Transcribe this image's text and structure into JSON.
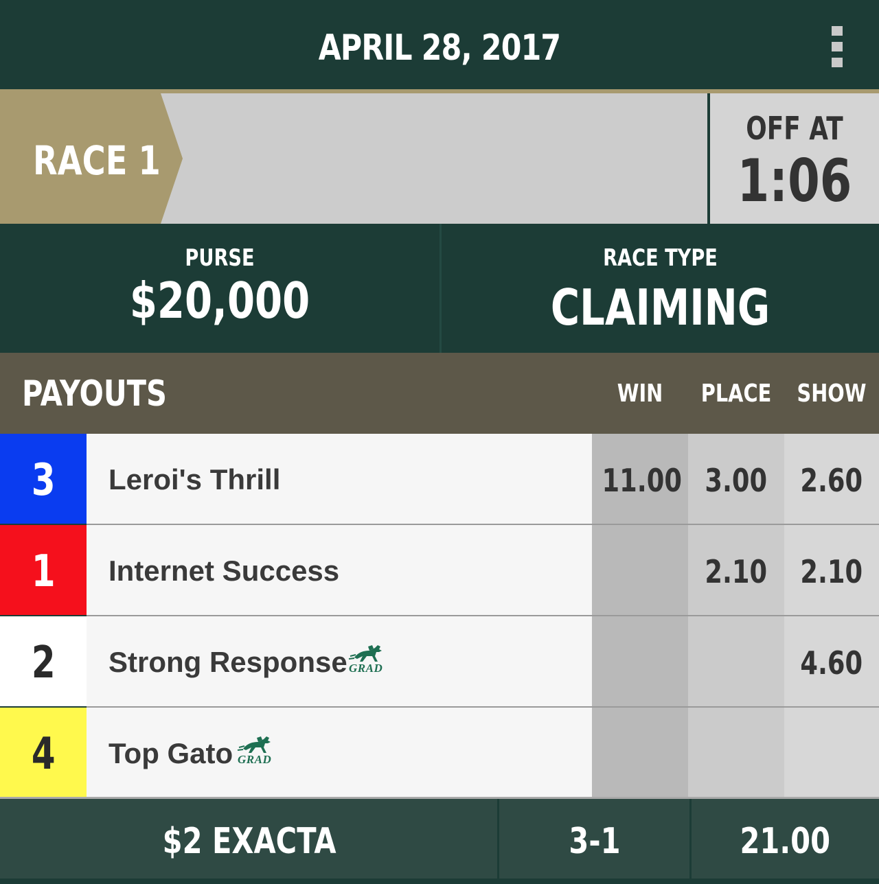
{
  "header": {
    "date": "APRIL 28, 2017",
    "menu_icon": "more-vertical-icon"
  },
  "race": {
    "label": "RACE 1",
    "off_label": "OFF AT",
    "off_time": "1:06"
  },
  "info": {
    "purse_label": "PURSE",
    "purse_value": "$20,000",
    "race_type_label": "RACE TYPE",
    "race_type_value": "CLAIMING"
  },
  "payouts": {
    "title": "PAYOUTS",
    "columns": [
      "WIN",
      "PLACE",
      "SHOW"
    ],
    "rows": [
      {
        "number": "3",
        "name": "Leroi's Thrill",
        "win": "11.00",
        "place": "3.00",
        "show": "2.60",
        "saddle_color": "#0a3cf0",
        "number_color": "#ffffff",
        "grad": false
      },
      {
        "number": "1",
        "name": "Internet Success",
        "win": "",
        "place": "2.10",
        "show": "2.10",
        "saddle_color": "#f5101c",
        "number_color": "#ffffff",
        "grad": false
      },
      {
        "number": "2",
        "name": "Strong Response",
        "win": "",
        "place": "",
        "show": "4.60",
        "saddle_color": "#ffffff",
        "number_color": "#2a2a2a",
        "grad": true,
        "grad_label": "GRAD"
      },
      {
        "number": "4",
        "name": "Top Gato",
        "win": "",
        "place": "",
        "show": "",
        "saddle_color": "#fff94d",
        "number_color": "#2a2a2a",
        "grad": true,
        "grad_label": "GRAD"
      }
    ]
  },
  "exotic": {
    "label": "$2 EXACTA",
    "combo": "3-1",
    "payout": "21.00"
  },
  "colors": {
    "dark_green": "#1c3c36",
    "gold": "#a89a6f",
    "payout_header": "#5d5849",
    "grad_green": "#1e6f52"
  }
}
